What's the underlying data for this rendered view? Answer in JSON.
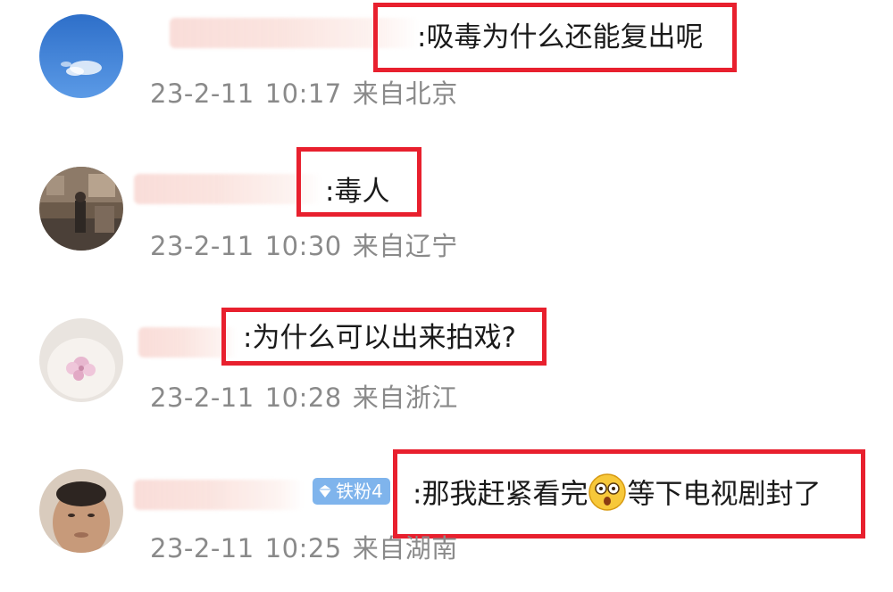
{
  "comments": [
    {
      "text": ":吸毒为什么还能复出呢",
      "date": "23-2-11",
      "time": "10:17",
      "location": "来自北京"
    },
    {
      "text": ":毒人",
      "date": "23-2-11",
      "time": "10:30",
      "location": "来自辽宁"
    },
    {
      "text": ":为什么可以出来拍戏?",
      "date": "23-2-11",
      "time": "10:28",
      "location": "来自浙江"
    },
    {
      "text_before": ":那我赶紧看完",
      "text_after": "等下电视剧封了",
      "emoji_name": "shocked-face-icon",
      "fan_badge": "铁粉4",
      "date": "23-2-11",
      "time": "10:25",
      "location": "来自湖南"
    }
  ],
  "colors": {
    "highlight": "#e8202e",
    "meta_text": "#8a8a8a",
    "badge": "#7fb4ec"
  }
}
